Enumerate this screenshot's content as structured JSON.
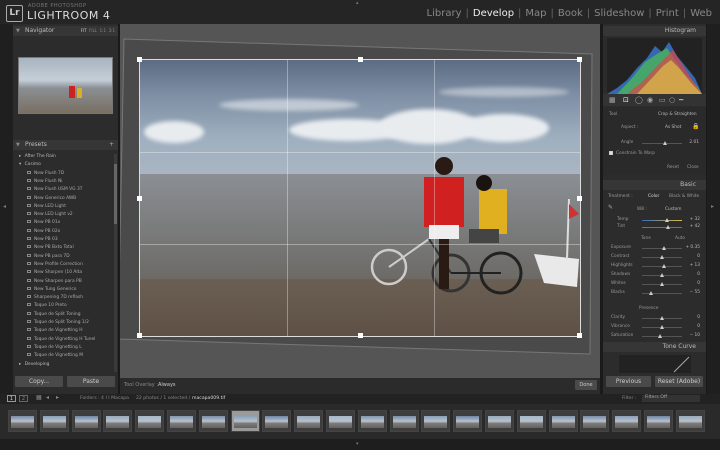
{
  "app": {
    "logo": "Lr",
    "brand_small": "ADOBE PHOTOSHOP",
    "brand_big": "LIGHTROOM 4",
    "modules": [
      "Library",
      "Develop",
      "Map",
      "Book",
      "Slideshow",
      "Print",
      "Web"
    ],
    "active_module": "Develop"
  },
  "navigator": {
    "title": "Navigator",
    "zoom_options": [
      "FIT",
      "FILL",
      "1:1",
      "3:1"
    ]
  },
  "presets": {
    "title": "Presets",
    "add_symbol": "+",
    "items": [
      {
        "label": "After The Rain",
        "folder": true
      },
      {
        "label": "Cosimo",
        "folder": true
      },
      {
        "label": "New Flush 7D",
        "folder": false
      },
      {
        "label": "New Flush Ni",
        "folder": false
      },
      {
        "label": "New Flush USM VG 3T",
        "folder": false
      },
      {
        "label": "New Generico AWB",
        "folder": false
      },
      {
        "label": "New LED Light",
        "folder": false
      },
      {
        "label": "New LED Light v2",
        "folder": false
      },
      {
        "label": "New PB 01x",
        "folder": false
      },
      {
        "label": "New PB 02x",
        "folder": false
      },
      {
        "label": "New PB 03",
        "folder": false
      },
      {
        "label": "New PB Bxto Total",
        "folder": false
      },
      {
        "label": "New PB para 7D",
        "folder": false
      },
      {
        "label": "New Profile Correction",
        "folder": false
      },
      {
        "label": "New Sharpen (10 Alta",
        "folder": false
      },
      {
        "label": "New Sharpen para PB",
        "folder": false
      },
      {
        "label": "New Tung Generico",
        "folder": false
      },
      {
        "label": "Sharpening 7D reflash",
        "folder": false
      },
      {
        "label": "Toque 10 Preto",
        "folder": false
      },
      {
        "label": "Toque de Split Toning",
        "folder": false
      },
      {
        "label": "Toque de Split Toning 1/2",
        "folder": false
      },
      {
        "label": "Toque de Vignetting H",
        "folder": false
      },
      {
        "label": "Toque de Vignetting H Tunel",
        "folder": false
      },
      {
        "label": "Toque de Vignetting L",
        "folder": false
      },
      {
        "label": "Toque de Vignetting M",
        "folder": false
      },
      {
        "label": "Developing",
        "folder": true
      }
    ],
    "copy_label": "Copy...",
    "paste_label": "Paste"
  },
  "center": {
    "tool_overlay_label": "Tool Overlay :",
    "tool_overlay_value": "Always",
    "done_label": "Done"
  },
  "histogram": {
    "title": "Histogram"
  },
  "crop": {
    "tool_label": "Tool",
    "tool_value": "Crop & Straighten",
    "aspect_label": "Aspect :",
    "aspect_value": "As Shot",
    "angle_label": "Angle",
    "angle_value": "2.01",
    "constrain_label": "Constrain To Warp",
    "reset_label": "Reset",
    "close_label": "Close"
  },
  "basic": {
    "title": "Basic",
    "treatment_label": "Treatment :",
    "color_label": "Color",
    "bw_label": "Black & White",
    "wb_label": "WB :",
    "wb_value": "Custom",
    "temp_label": "Temp",
    "temp_value": "+ 32",
    "tint_label": "Tint",
    "tint_value": "+ 42",
    "tone_label": "Tone",
    "auto_label": "Auto",
    "sliders": [
      {
        "label": "Exposure",
        "value": "+ 0.35",
        "pos": 0.55
      },
      {
        "label": "Contrast",
        "value": "0",
        "pos": 0.5
      },
      {
        "label": "Highlights",
        "value": "+ 13",
        "pos": 0.56
      },
      {
        "label": "Shadows",
        "value": "0",
        "pos": 0.5
      },
      {
        "label": "Whites",
        "value": "0",
        "pos": 0.5
      },
      {
        "label": "Blacks",
        "value": "− 55",
        "pos": 0.22
      }
    ],
    "presence_label": "Presence",
    "presence_sliders": [
      {
        "label": "Clarity",
        "value": "0",
        "pos": 0.5
      },
      {
        "label": "Vibrance",
        "value": "0",
        "pos": 0.5
      },
      {
        "label": "Saturation",
        "value": "− 10",
        "pos": 0.45
      }
    ]
  },
  "tone_curve": {
    "title": "Tone Curve"
  },
  "right_buttons": {
    "previous": "Previous",
    "reset": "Reset (Adobe)"
  },
  "filmstrip_header": {
    "screen1": "1",
    "screen2": "2",
    "source_label": "Folders : 4 I I Macapa",
    "count_label": "22 photos / 1 selected /",
    "filename": "macapa009.tif",
    "filter_label": "Filter :",
    "filter_value": "Filters Off"
  },
  "filmstrip": {
    "count": 22,
    "selected_index": 7
  }
}
